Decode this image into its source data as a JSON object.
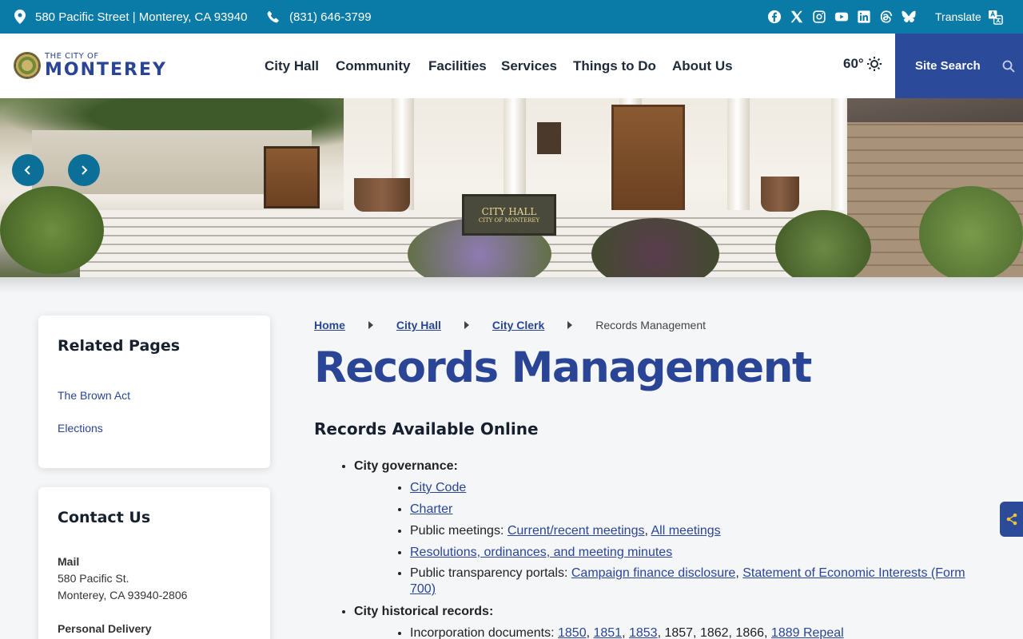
{
  "topbar": {
    "address": "580 Pacific Street | Monterey, CA 93940",
    "phone": "(831) 646-3799",
    "social_icons": [
      "facebook-icon",
      "x-icon",
      "instagram-icon",
      "youtube-icon",
      "linkedin-icon",
      "threads-icon",
      "bluesky-icon"
    ],
    "translate_label": "Translate"
  },
  "header": {
    "logo_small": "THE CITY OF",
    "logo_big": "MONTEREY",
    "nav": [
      "City Hall",
      "Community",
      "Facilities",
      "Services",
      "Things to Do",
      "About Us"
    ],
    "weather": "60°",
    "search_label": "Site Search"
  },
  "hero": {
    "sign_line1": "CITY HALL",
    "sign_line2": "CITY OF MONTEREY"
  },
  "sidebar": {
    "related_title": "Related Pages",
    "related_links": [
      "The Brown Act",
      "Elections"
    ],
    "contact_title": "Contact Us",
    "mail_label": "Mail",
    "mail_line1": "580 Pacific St.",
    "mail_line2": "Monterey, CA 93940-2806",
    "delivery_label": "Personal Delivery"
  },
  "breadcrumb": [
    "Home",
    "City Hall",
    "City Clerk",
    "Records Management"
  ],
  "page": {
    "title": "Records Management",
    "section_title": "Records Available Online",
    "governance_label": "City governance:",
    "city_code": "City Code",
    "charter": "Charter",
    "meetings_prefix": "Public meetings: ",
    "meetings_current": "Current/recent meetings",
    "meetings_all": "All meetings",
    "resolutions": "Resolutions, ordinances, and meeting minutes",
    "transparency_prefix": "Public transparency portals: ",
    "campaign": "Campaign finance disclosure",
    "econ": "Statement of Economic Interests (Form 700)",
    "historical_label": "City historical records:",
    "incorp_prefix": "Incorporation documents: ",
    "incorp_1850": "1850",
    "incorp_1851": "1851",
    "incorp_1853": "1853",
    "incorp_plain": "1857, 1862, 1866,",
    "incorp_1889": "1889 Repeal"
  },
  "colors": {
    "topbar": "#0a7aa6",
    "brand_blue": "#2a4595",
    "search_bg": "#2b4a9a"
  }
}
